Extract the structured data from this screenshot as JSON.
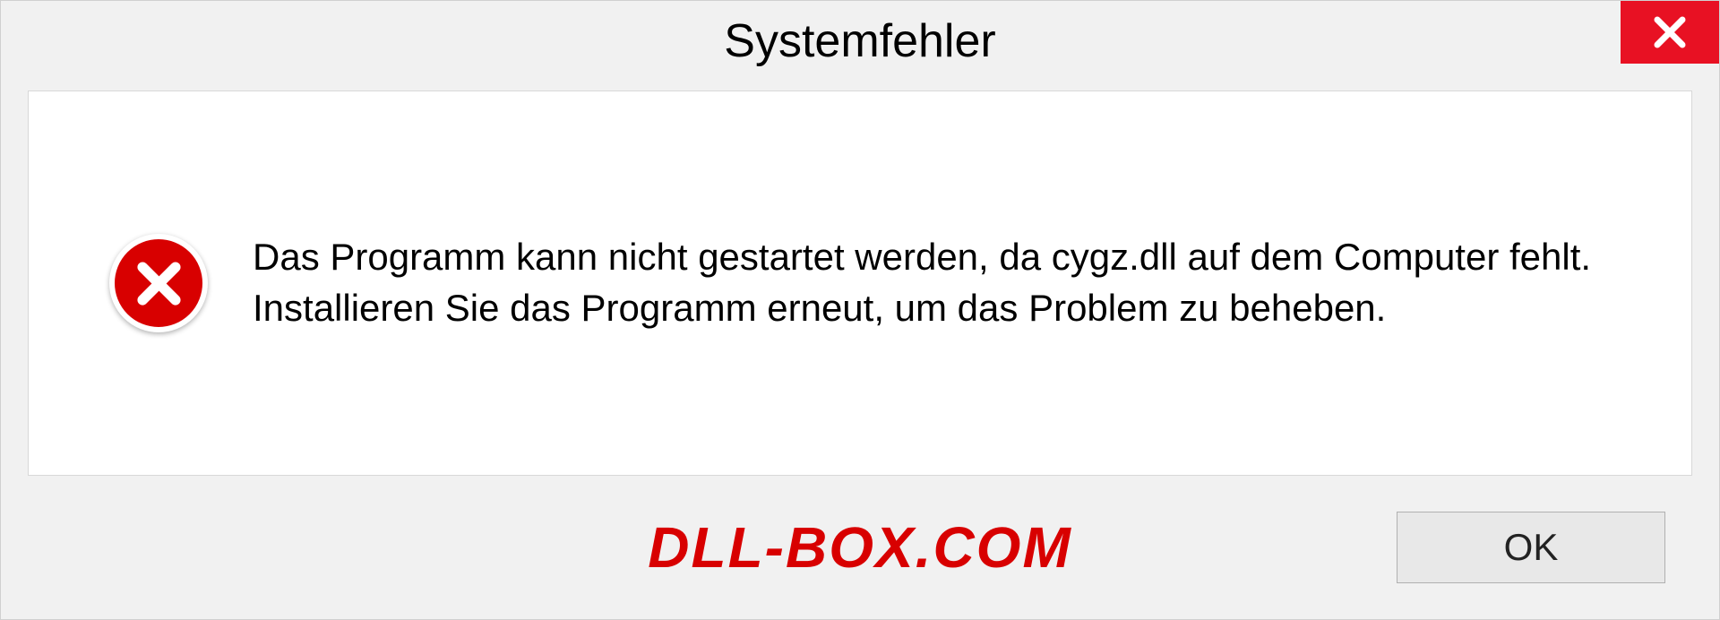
{
  "dialog": {
    "title": "Systemfehler",
    "message": "Das Programm kann nicht gestartet werden, da cygz.dll auf dem Computer fehlt. Installieren Sie das Programm erneut, um das Problem zu beheben.",
    "ok_label": "OK"
  },
  "watermark": "DLL-BOX.COM"
}
